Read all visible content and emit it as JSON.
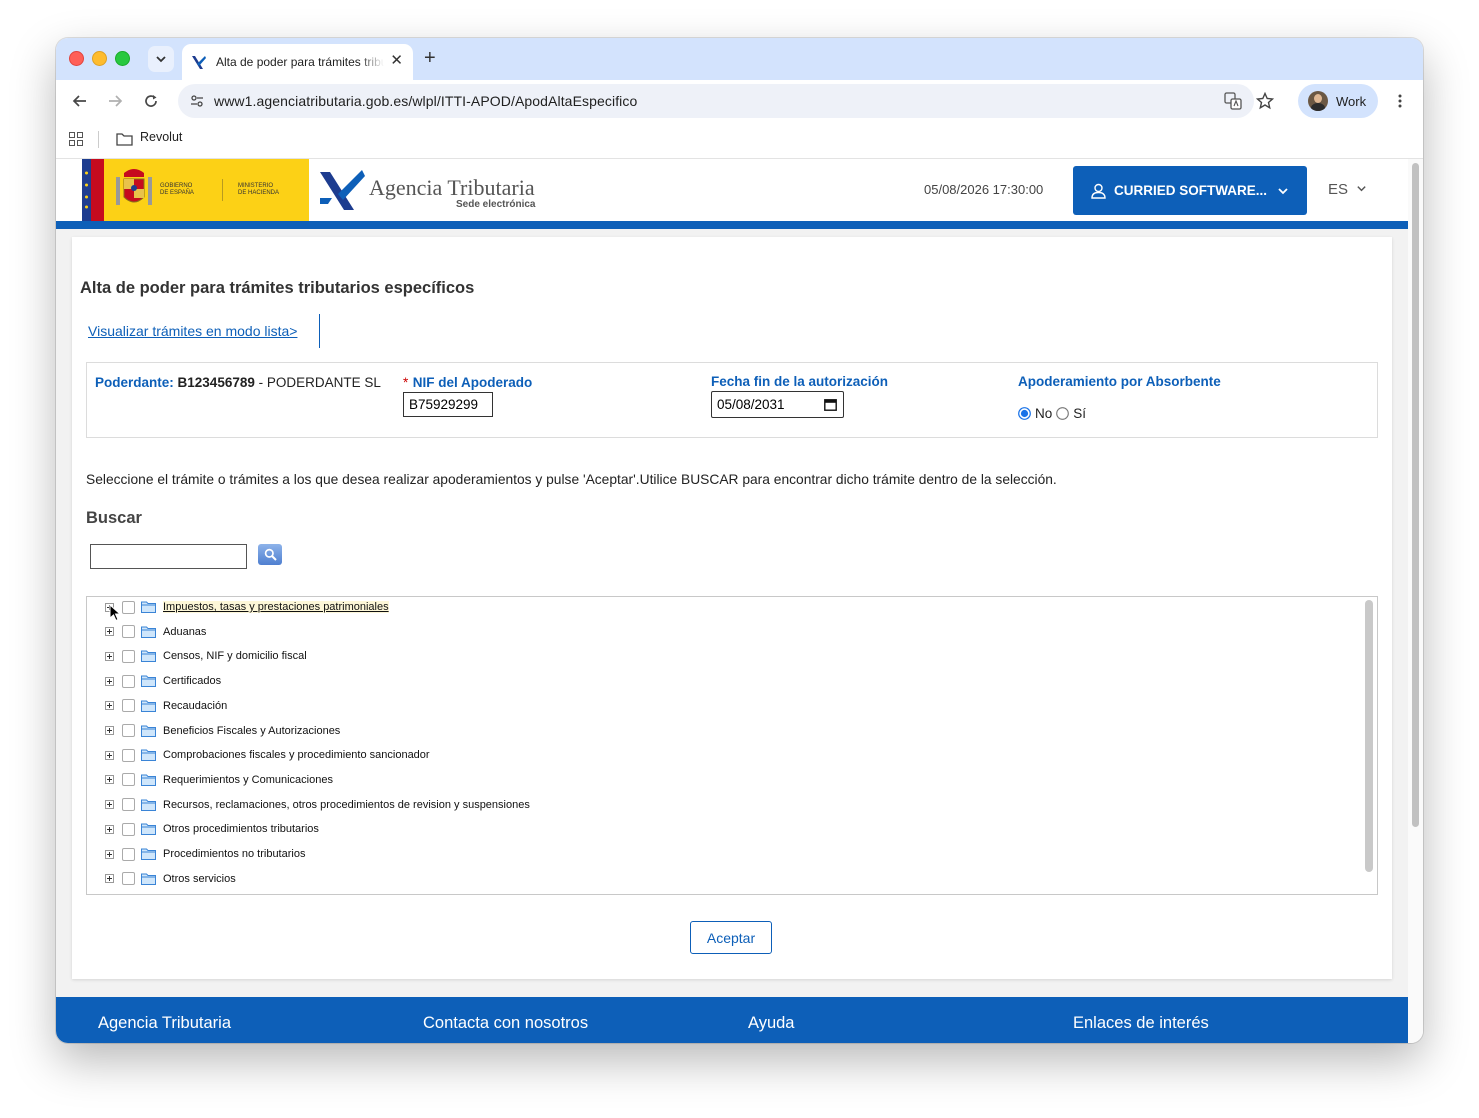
{
  "browser": {
    "tab_title": "Alta de poder para trámites tributarios específicos",
    "tab_close": "✕",
    "new_tab": "+",
    "url": "www1.agenciatributaria.gob.es/wlpl/ITTI-APOD/ApodAltaEspecifico",
    "profile_label": "Work",
    "bookmark": "Revolut"
  },
  "header": {
    "gov_line1": "GOBIERNO",
    "gov_line2": "DE ESPAÑA",
    "min_line1": "MINISTERIO",
    "min_line2": "DE HACIENDA",
    "agency_name": "Agencia Tributaria",
    "agency_sub": "Sede electrónica",
    "datetime": "05/08/2026 17:30:00",
    "user_label": "CURRIED SOFTWARE...",
    "language": "ES"
  },
  "main": {
    "title": "Alta de poder para trámites tributarios específicos",
    "list_link": "Visualizar trámites en modo lista>",
    "poderdante_label": "Poderdante:",
    "poderdante_nif": "B123456789",
    "poderdante_name": "- PODERDANTE SL",
    "nif_required": "*",
    "nif_label": "NIF del Apoderado",
    "nif_value": "B75929299",
    "fecha_label": "Fecha fin de la autorización",
    "fecha_value": "05/08/2031",
    "absorbente_label": "Apoderamiento por Absorbente",
    "radio_no": "No",
    "radio_si": "Sí",
    "radio_selected": "No",
    "instructions": "Seleccione el trámite o trámites a los que desea realizar apoderamientos y pulse 'Aceptar'.Utilice BUSCAR para encontrar dicho trámite dentro de la selección.",
    "buscar_label": "Buscar",
    "search_value": "",
    "tree_items": [
      "Impuestos, tasas y prestaciones patrimoniales",
      "Aduanas",
      "Censos, NIF y domicilio fiscal",
      "Certificados",
      "Recaudación",
      "Beneficios Fiscales y Autorizaciones",
      "Comprobaciones fiscales y procedimiento sancionador",
      "Requerimientos y Comunicaciones",
      "Recursos, reclamaciones, otros procedimientos de revision y suspensiones",
      "Otros procedimientos tributarios",
      "Procedimientos no tributarios",
      "Otros servicios"
    ],
    "accept_label": "Aceptar"
  },
  "footer": {
    "items": [
      "Agencia Tributaria",
      "Contacta con nosotros",
      "Ayuda",
      "Enlaces de interés"
    ]
  },
  "colors": {
    "brand_blue": "#0d5fb8",
    "gov_yellow": "#fcd116",
    "tab_strip": "#d3e3fd"
  }
}
